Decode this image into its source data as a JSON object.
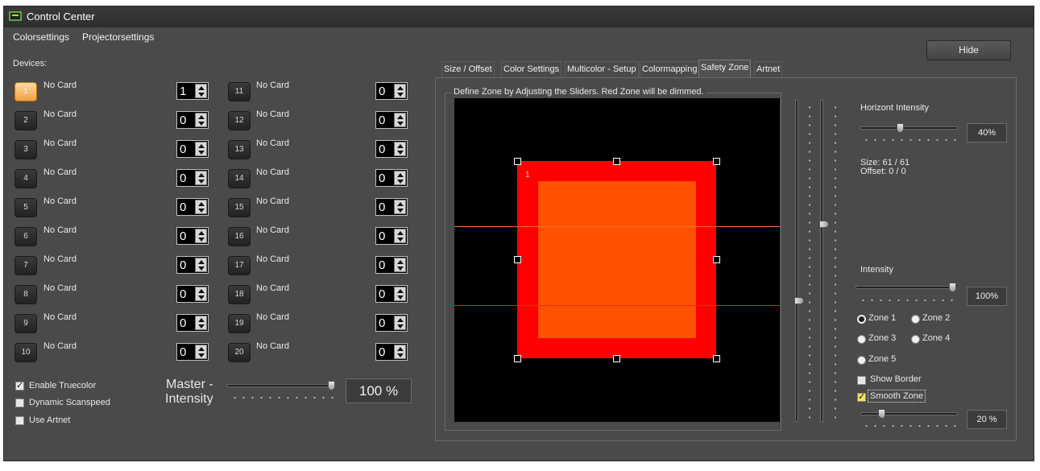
{
  "window": {
    "title": "Control Center"
  },
  "menu": {
    "items": [
      "Colorsettings",
      "Projectorsettings"
    ]
  },
  "devices": {
    "label": "Devices:",
    "active_index": 0,
    "left": [
      {
        "number": "1",
        "card": "No Card",
        "value": "1"
      },
      {
        "number": "2",
        "card": "No Card",
        "value": "0"
      },
      {
        "number": "3",
        "card": "No Card",
        "value": "0"
      },
      {
        "number": "4",
        "card": "No Card",
        "value": "0"
      },
      {
        "number": "5",
        "card": "No Card",
        "value": "0"
      },
      {
        "number": "6",
        "card": "No Card",
        "value": "0"
      },
      {
        "number": "7",
        "card": "No Card",
        "value": "0"
      },
      {
        "number": "8",
        "card": "No Card",
        "value": "0"
      },
      {
        "number": "9",
        "card": "No Card",
        "value": "0"
      },
      {
        "number": "10",
        "card": "No Card",
        "value": "0"
      }
    ],
    "right": [
      {
        "number": "11",
        "card": "No Card",
        "value": "0"
      },
      {
        "number": "12",
        "card": "No Card",
        "value": "0"
      },
      {
        "number": "13",
        "card": "No Card",
        "value": "0"
      },
      {
        "number": "14",
        "card": "No Card",
        "value": "0"
      },
      {
        "number": "15",
        "card": "No Card",
        "value": "0"
      },
      {
        "number": "16",
        "card": "No Card",
        "value": "0"
      },
      {
        "number": "17",
        "card": "No Card",
        "value": "0"
      },
      {
        "number": "18",
        "card": "No Card",
        "value": "0"
      },
      {
        "number": "19",
        "card": "No Card",
        "value": "0"
      },
      {
        "number": "20",
        "card": "No Card",
        "value": "0"
      }
    ]
  },
  "options": {
    "enable_truecolor": {
      "label": "Enable Truecolor",
      "checked": true
    },
    "dynamic_scanspeed": {
      "label": "Dynamic Scanspeed",
      "checked": false
    },
    "use_artnet": {
      "label": "Use Artnet",
      "checked": false
    }
  },
  "master": {
    "label_line1": "Master -",
    "label_line2": "Intensity",
    "value": "100 %",
    "level": 1.0
  },
  "hide_button": "Hide",
  "tabs": {
    "items": [
      "Size / Offset",
      "Color Settings",
      "Multicolor - Setup",
      "Colormapping",
      "Safety Zone",
      "Artnet"
    ],
    "active": "Safety Zone"
  },
  "safety_zone": {
    "instruction": "Define Zone by Adjusting the Sliders. Red Zone will be dimmed.",
    "zone_label": "1",
    "horizont_intensity": {
      "label": "Horizont Intensity",
      "value": "40%",
      "level": 0.4
    },
    "size_text": "Size:  61 / 61",
    "offset_text": "Offset: 0 / 0",
    "intensity": {
      "label": "Intensity",
      "value": "100%",
      "level": 1.0
    },
    "zones": [
      {
        "label": "Zone 1",
        "selected": true
      },
      {
        "label": "Zone 2",
        "selected": false
      },
      {
        "label": "Zone 3",
        "selected": false
      },
      {
        "label": "Zone 4",
        "selected": false
      },
      {
        "label": "Zone 5",
        "selected": false
      }
    ],
    "show_border": {
      "label": "Show Border",
      "checked": false
    },
    "smooth_zone": {
      "label": "Smooth Zone",
      "checked": true,
      "value": "20 %",
      "level": 0.2
    }
  },
  "colors": {
    "background": "#4a4a4a",
    "active_device": "#f0a040",
    "zone_red": "#ff0000",
    "zone_inner": "#ff5200",
    "canvas": "#000000"
  }
}
